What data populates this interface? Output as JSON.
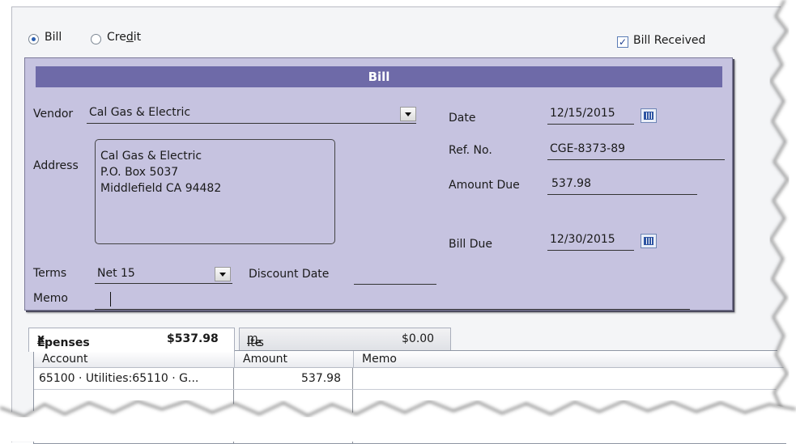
{
  "type_selector": {
    "options": [
      {
        "label": "Bill",
        "selected": true
      },
      {
        "label": "Credit",
        "selected": false
      }
    ],
    "bill_received": {
      "label": "Bill Received",
      "checked": true,
      "mark": "✓"
    }
  },
  "bill_form": {
    "header": "Bill",
    "vendor": {
      "label": "Vendor",
      "value": "Cal Gas & Electric"
    },
    "address": {
      "label": "Address",
      "lines": "Cal Gas & Electric\nP.O. Box 5037\nMiddlefield CA 94482"
    },
    "terms": {
      "label": "Terms",
      "value": "Net 15"
    },
    "discount_date": {
      "label": "Discount Date",
      "value": ""
    },
    "memo": {
      "label": "Memo",
      "value": ""
    },
    "date": {
      "label": "Date",
      "value": "12/15/2015"
    },
    "ref_no": {
      "label": "Ref. No.",
      "value": "CGE-8373-89"
    },
    "amount_due": {
      "label": "Amount Due",
      "value": "537.98"
    },
    "bill_due": {
      "label": "Bill Due",
      "value": "12/30/2015"
    }
  },
  "tabs": [
    {
      "label_pre": "E",
      "label_ul": "x",
      "label_post": "penses",
      "amount": "$537.98",
      "active": true
    },
    {
      "label_pre": "Ite",
      "label_ul": "m",
      "label_post": "s",
      "amount": "$0.00",
      "active": false
    }
  ],
  "expenses_table": {
    "columns": [
      "Account",
      "Amount",
      "Memo"
    ],
    "rows": [
      {
        "account": "65100 · Utilities:65110 · G...",
        "amount": "537.98",
        "memo": ""
      }
    ]
  },
  "colors": {
    "form_background": "#c6c3e0",
    "header_bar": "#6e6aa8"
  },
  "icons": [
    "calendar-icon",
    "dropdown-arrow-icon",
    "checkmark-icon"
  ]
}
